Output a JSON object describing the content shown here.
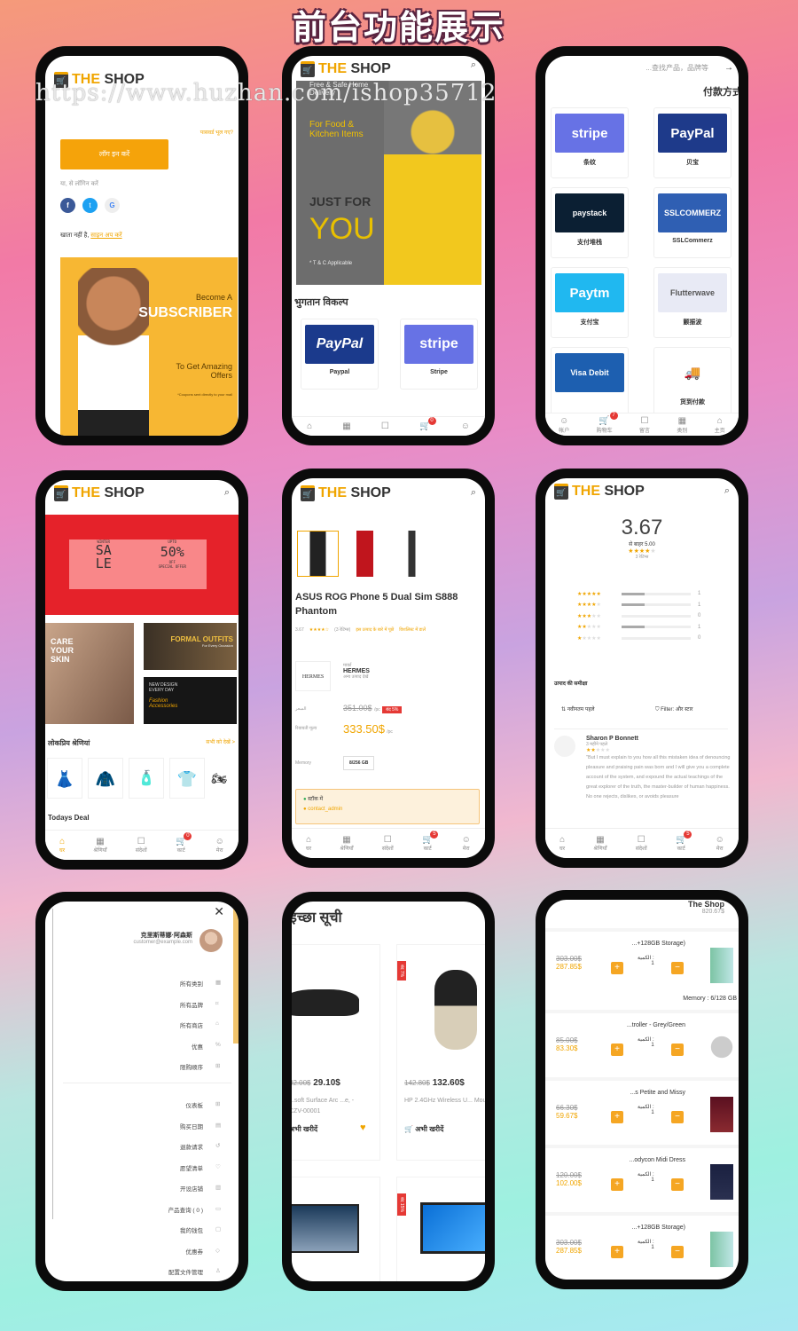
{
  "page_title": "前台功能展示",
  "watermark": "https://www.huzhan.com/ishop35712",
  "brand": {
    "the": "THE",
    "shop": "SHOP",
    "accent": "#f0a500"
  },
  "login": {
    "forgot": "पासवर्ड भूल गए?",
    "login_button": "लॉग इन करें",
    "or_login_with": "या, से लॉगिन करें",
    "no_account": "खाता नहीं है,",
    "signup": "साइन अप करें",
    "banner": {
      "become": "Become A",
      "subscriber": "SUBSCRIBER",
      "offer": "To Get Amazing Offers",
      "note": "*Coupons sent directly to your mail"
    }
  },
  "home_hi": {
    "banner": {
      "delivery": "Free & Safe Home Delivery",
      "food": "For Food & Kitchen Items",
      "just": "JUST FOR",
      "you": "YOU",
      "tc": "* T & C Applicable"
    },
    "payment_heading": "भुगतान विकल्प",
    "payments": [
      {
        "logo": "PayPal",
        "label": "Paypal"
      },
      {
        "logo": "stripe",
        "label": "Stripe"
      }
    ],
    "cart_count": "0"
  },
  "payments_cn": {
    "search_placeholder": "...查找产品，品牌等",
    "heading": "付款方式",
    "methods": [
      {
        "logo": "stripe",
        "label": "条纹",
        "color": "#6772e5"
      },
      {
        "logo": "PayPal",
        "label": "贝宝",
        "color": "#1e3a8a"
      },
      {
        "logo": "paystack",
        "label": "支付堆栈",
        "color": "#0b1f33"
      },
      {
        "logo": "SSLCOMMERZ",
        "label": "SSLCommerz",
        "color": "#2f5fb3"
      },
      {
        "logo": "Paytm",
        "label": "支付宝",
        "color": "#20b8f0"
      },
      {
        "logo": "Flutterwave",
        "label": "颤振波",
        "color": "#e8eaf5"
      },
      {
        "logo": "Visa Debit",
        "label": "",
        "color": "#1d5fb0"
      },
      {
        "logo": "truck",
        "label": "货到付款",
        "color": "#ffffff"
      }
    ],
    "nav": [
      "帐户",
      "购物车",
      "留言",
      "类别",
      "主页"
    ],
    "cart_count": "7"
  },
  "home": {
    "sale": {
      "winter": "WINTER",
      "sale": "SA LE",
      "upto": "UPTO",
      "pct": "50%",
      "off": "OFF",
      "special": "SPECIAL OFFER"
    },
    "care": "CARE YOUR SKIN",
    "formal": "FORMAL OUTFITS",
    "formal_sub": "For Every Occasion",
    "newdesign": "NEW DESIGN EVERY DAY",
    "fashion": "Fashion Accessories",
    "popular": "लोकप्रिय श्रेणियां",
    "view_all": "सभी को देखें >",
    "todays_deal": "Todays Deal",
    "cart_count": "0"
  },
  "nav_hi": [
    "घर",
    "श्रेणियाँ",
    "संदेशों",
    "कार्ट",
    "मेरा"
  ],
  "product": {
    "title": "ASUS ROG Phone 5 Dual Sim S888 Phantom",
    "rating": "3.67",
    "reviews": "(3 रेटिंग्स)",
    "ask": "इस उत्पाद के बारे में पूछें",
    "wishlist": "विशलिस्ट में डालें",
    "brand_label": "मार्का",
    "brand": "HERMES",
    "brand_sub": "अन्य उत्पाद देखें",
    "price_label": "السعر",
    "old_price": "351.00$",
    "unit": "/pc",
    "discount": "बंद 5%",
    "sale_label": "रियायती मूल्य",
    "price": "333.50$",
    "memory_label": "Memory",
    "memory": "8/256 GB",
    "stock": "स्टॉक में",
    "seller": "contact_admin",
    "cart_count": "5"
  },
  "reviews": {
    "score": "3.67",
    "out_of": "से बाहर 5.00",
    "count": "3 रेटिंग्स",
    "bars": [
      {
        "stars": 5,
        "count": 1,
        "fill": 0.33
      },
      {
        "stars": 4,
        "count": 1,
        "fill": 0.33
      },
      {
        "stars": 3,
        "count": 0,
        "fill": 0
      },
      {
        "stars": 2,
        "count": 1,
        "fill": 0.33
      },
      {
        "stars": 1,
        "count": 0,
        "fill": 0
      }
    ],
    "heading": "उत्पाद की समीक्षा",
    "sort": "नवीनतम पहले",
    "filter": "Filter: और स्टार",
    "reviewer": "Sharon P Bonnett",
    "when": "3 महीने पहले",
    "review_stars": 2,
    "text": "\"But I must explain to you how all this mistaken idea of denouncing pleasure and praising pain was born and I will give you a complete account of the system, and expound the actual teachings of the great explorer of the truth, the master-builder of human happiness. No one rejects, dislikes, or avoids pleasure",
    "cart_count": "5"
  },
  "drawer": {
    "name": "克里斯蒂娜·阿森斯",
    "email": "customer@example.com",
    "menu1": [
      {
        "label": "所有类别",
        "icon": "grid"
      },
      {
        "label": "所有品牌",
        "icon": "tag"
      },
      {
        "label": "所有商店",
        "icon": "store"
      },
      {
        "label": "优惠",
        "icon": "percent"
      },
      {
        "label": "限购顺序",
        "icon": "gift"
      }
    ],
    "menu2": [
      {
        "label": "仪表板",
        "icon": "dashboard"
      },
      {
        "label": "购买日期",
        "icon": "file"
      },
      {
        "label": "退款请求",
        "icon": "refund"
      },
      {
        "label": "愿望清单",
        "icon": "heart"
      },
      {
        "label": "开设店铺",
        "icon": "shop"
      },
      {
        "label": "产品查询 ( 0 )",
        "icon": "message"
      },
      {
        "label": "我的钱包",
        "icon": "wallet"
      },
      {
        "label": "优惠券",
        "icon": "coupon"
      },
      {
        "label": "配置文件管理",
        "icon": "user"
      }
    ]
  },
  "wishlist": {
    "heading": "इच्छा सूची",
    "items": [
      {
        "old": "32.00$",
        "price": "29.10$",
        "name": "...soft Surface Arc ...e, - CZV-00001",
        "buy": "अभी खरीदें",
        "discount": ""
      },
      {
        "old": "142.80$",
        "price": "132.60$",
        "name": "HP 2.4GHz Wireless U... Mouse Z3700 (Matte...",
        "buy": "अभी खरीदें",
        "discount": "बंद 7%"
      },
      {
        "discount": ""
      },
      {
        "discount": "बंद 15%"
      }
    ]
  },
  "cart": {
    "shop": "The Shop",
    "total": "820.67$",
    "qty_label": "الكمية :",
    "items": [
      {
        "name": "...+128GB Storage)",
        "old": "303.00$",
        "price": "287.85$",
        "qty": "1",
        "variant": "Memory : 6/128 GB"
      },
      {
        "name": "...troller - Grey/Green",
        "old": "85.00$",
        "price": "83.30$",
        "qty": "1"
      },
      {
        "name": "...s Petite and Missy",
        "old": "66.30$",
        "price": "59.67$",
        "qty": "1"
      },
      {
        "name": "...odycon Midi Dress",
        "old": "120.00$",
        "price": "102.00$",
        "qty": "1"
      },
      {
        "name": "...+128GB Storage)",
        "old": "303.00$",
        "price": "287.85$",
        "qty": "1"
      }
    ]
  }
}
